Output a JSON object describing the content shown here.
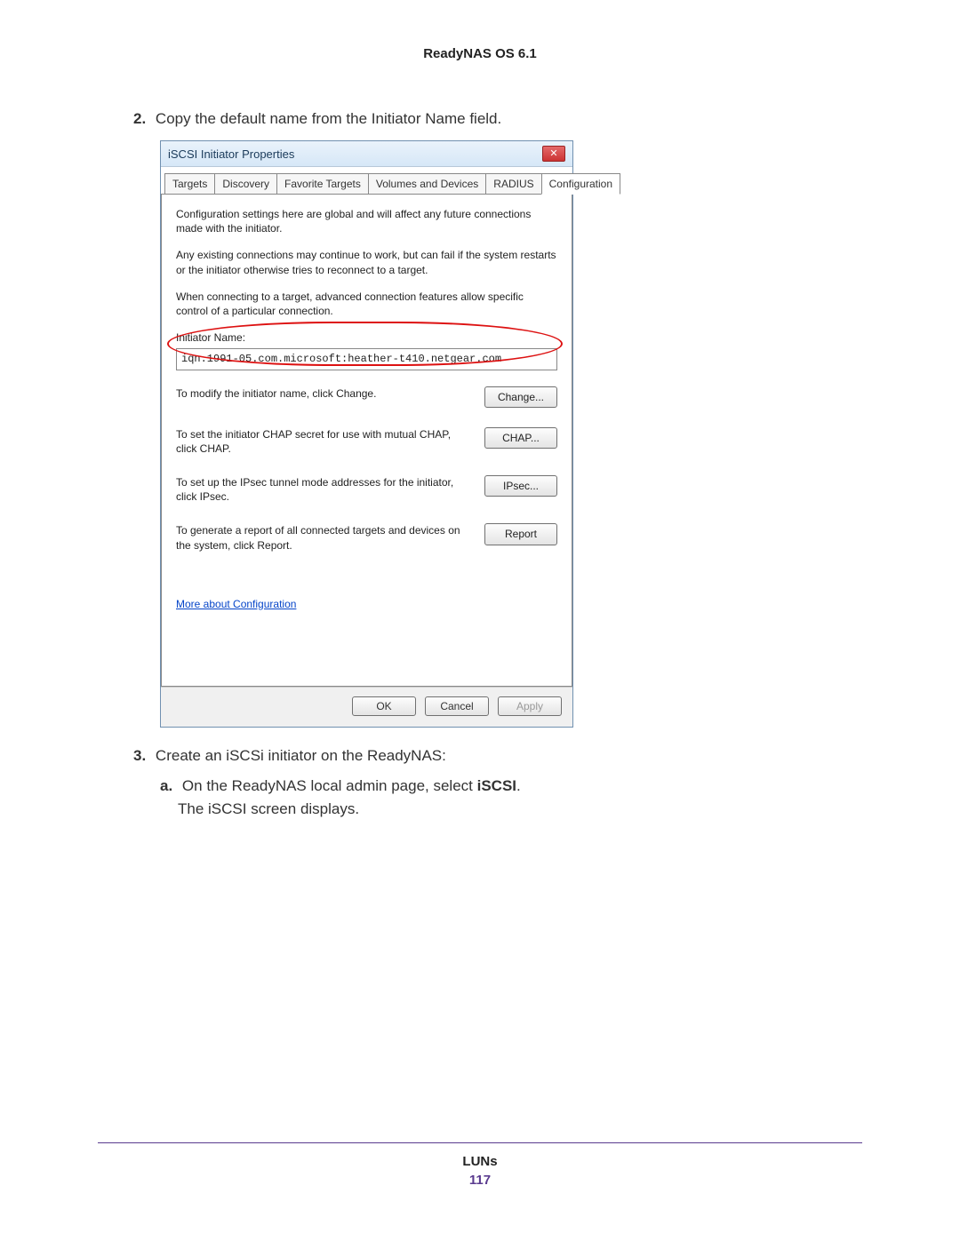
{
  "header": {
    "title": "ReadyNAS OS 6.1"
  },
  "steps": {
    "s2_num": "2.",
    "s2_text": "Copy the default name from the Initiator Name field.",
    "s3_num": "3.",
    "s3_text": "Create an iSCSi initiator on the ReadyNAS:",
    "s3a_letter": "a.",
    "s3a_text_before": "On the ReadyNAS local admin page, select ",
    "s3a_bold": "iSCSI",
    "s3a_after": ".",
    "s3a_line2": "The iSCSI screen displays."
  },
  "dialog": {
    "title": "iSCSI Initiator Properties",
    "close_glyph": "✕",
    "tabs": [
      "Targets",
      "Discovery",
      "Favorite Targets",
      "Volumes and Devices",
      "RADIUS",
      "Configuration"
    ],
    "para1": "Configuration settings here are global and will affect any future connections made with the initiator.",
    "para2": "Any existing connections may continue to work, but can fail if the system restarts or the initiator otherwise tries to reconnect to a target.",
    "para3": "When connecting to a target, advanced connection features allow specific control of a particular connection.",
    "initiator_label": "Initiator Name:",
    "initiator_value": "iqn.1991-05.com.microsoft:heather-t410.netgear.com",
    "row_change_text": "To modify the initiator name, click Change.",
    "row_change_btn": "Change...",
    "row_chap_text": "To set the initiator CHAP secret for use with mutual CHAP, click CHAP.",
    "row_chap_btn": "CHAP...",
    "row_ipsec_text": "To set up the IPsec tunnel mode addresses for the initiator, click IPsec.",
    "row_ipsec_btn": "IPsec...",
    "row_report_text": "To generate a report of all connected targets and devices on the system, click Report.",
    "row_report_btn": "Report",
    "more_link": "More about Configuration",
    "ok": "OK",
    "cancel": "Cancel",
    "apply": "Apply"
  },
  "footer": {
    "section": "LUNs",
    "page": "117"
  }
}
